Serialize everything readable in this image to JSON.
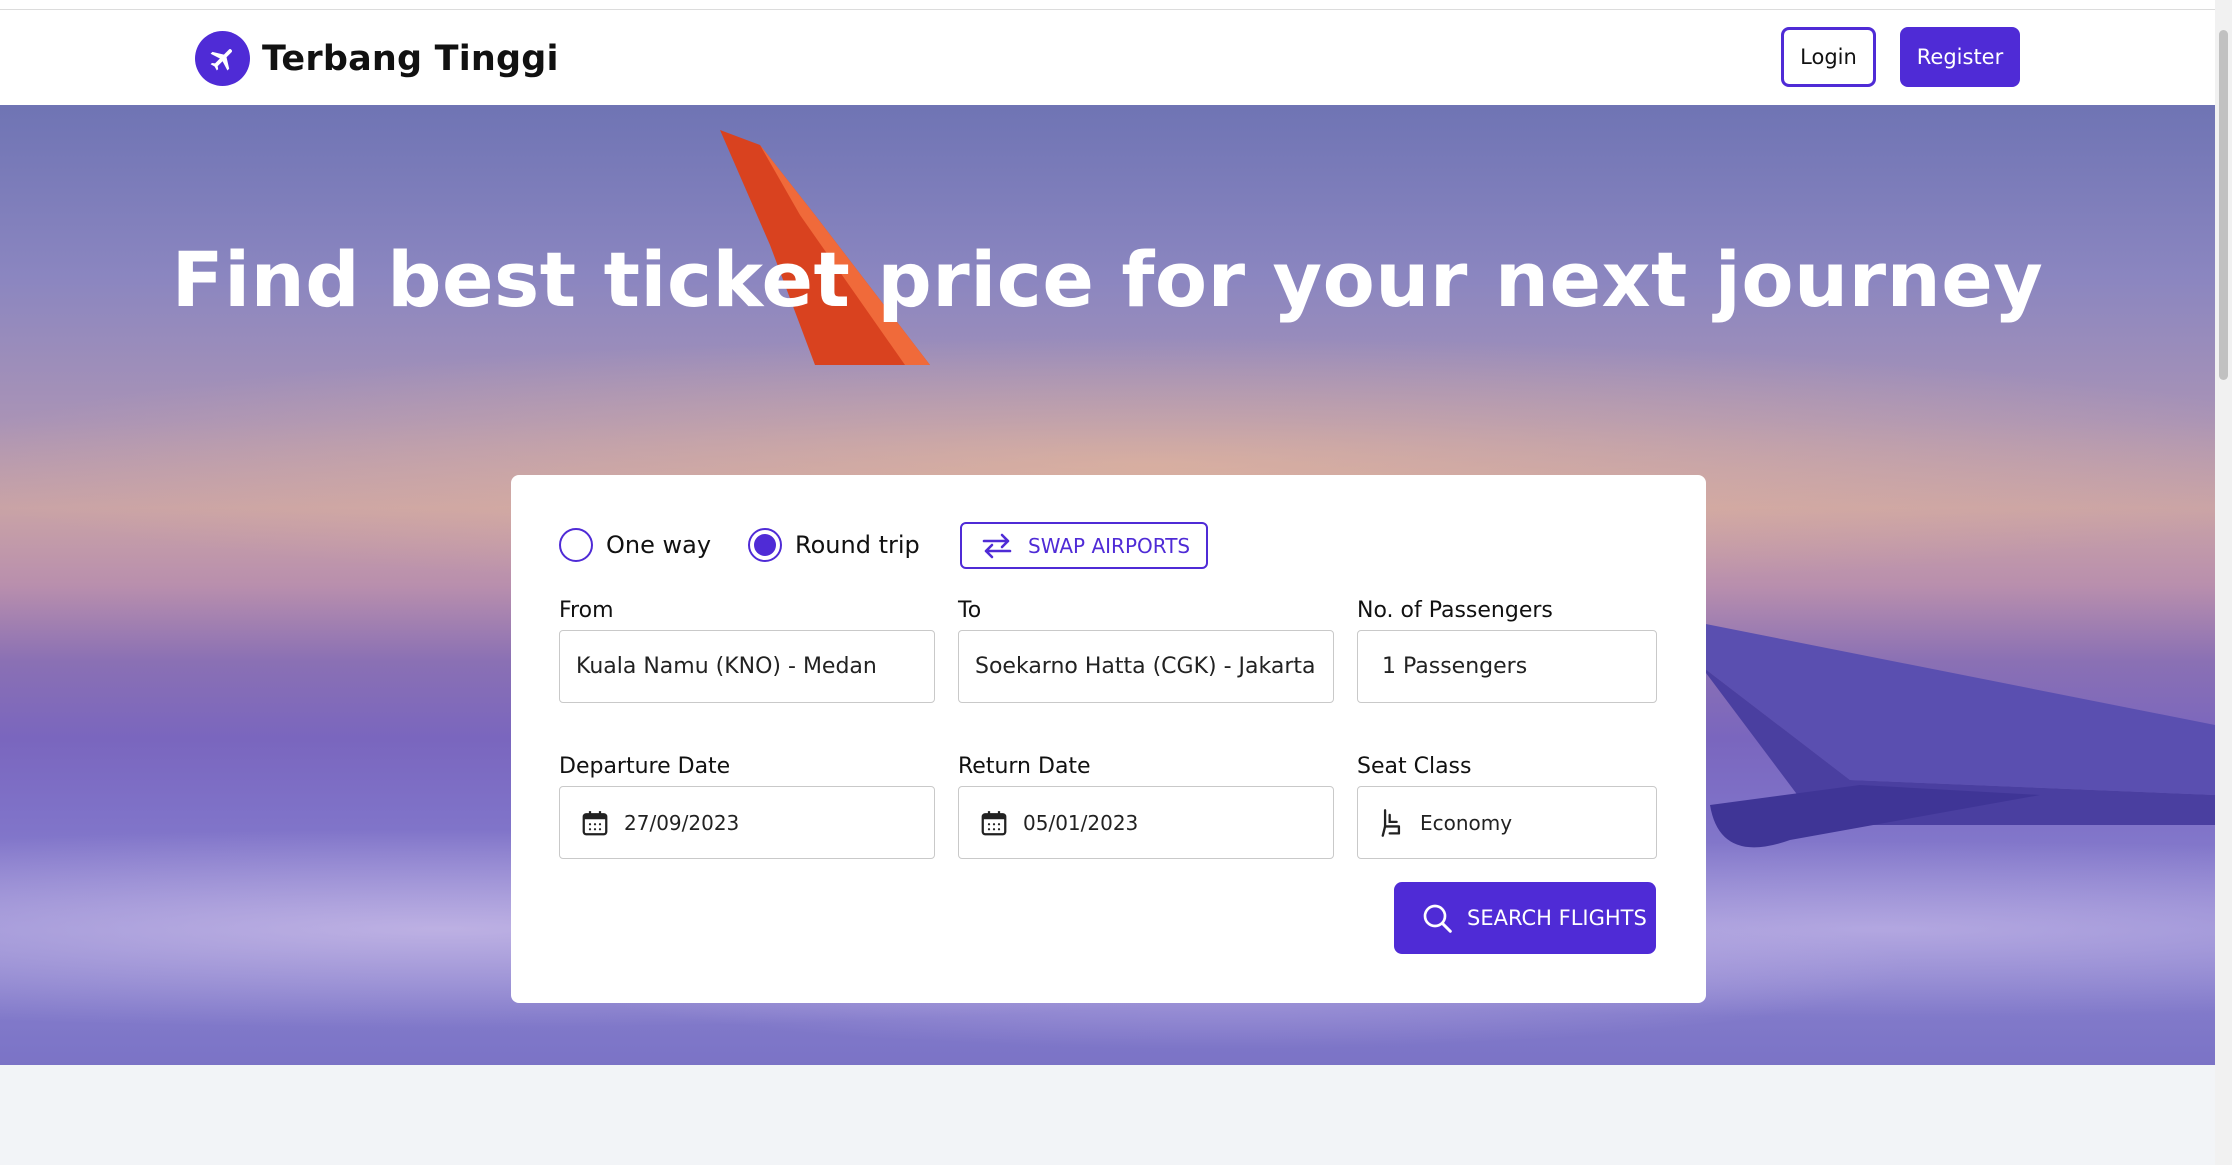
{
  "navbar": {
    "brand_name": "Terbang Tinggi",
    "brand_icon": "airplane-icon",
    "login_label": "Login",
    "register_label": "Register"
  },
  "hero": {
    "title": "Find best ticket price for your next journey"
  },
  "search_form": {
    "trip_types": [
      {
        "label": "One way",
        "selected": false
      },
      {
        "label": "Round trip",
        "selected": true
      }
    ],
    "swap_label": "SWAP AIRPORTS",
    "from": {
      "label": "From",
      "value": "Kuala Namu (KNO) - Medan"
    },
    "to": {
      "label": "To",
      "value": "Soekarno Hatta (CGK) - Jakarta"
    },
    "passengers": {
      "label": "No. of Passengers",
      "value": "1 Passengers"
    },
    "departure_date": {
      "label": "Departure Date",
      "value": "27/09/2023"
    },
    "return_date": {
      "label": "Return Date",
      "value": "05/01/2023"
    },
    "seat_class": {
      "label": "Seat Class",
      "value": "Economy"
    },
    "search_label": "SEARCH FLIGHTS"
  },
  "colors": {
    "primary": "#4f2bd6",
    "footer_bg": "#f2f4f7"
  }
}
